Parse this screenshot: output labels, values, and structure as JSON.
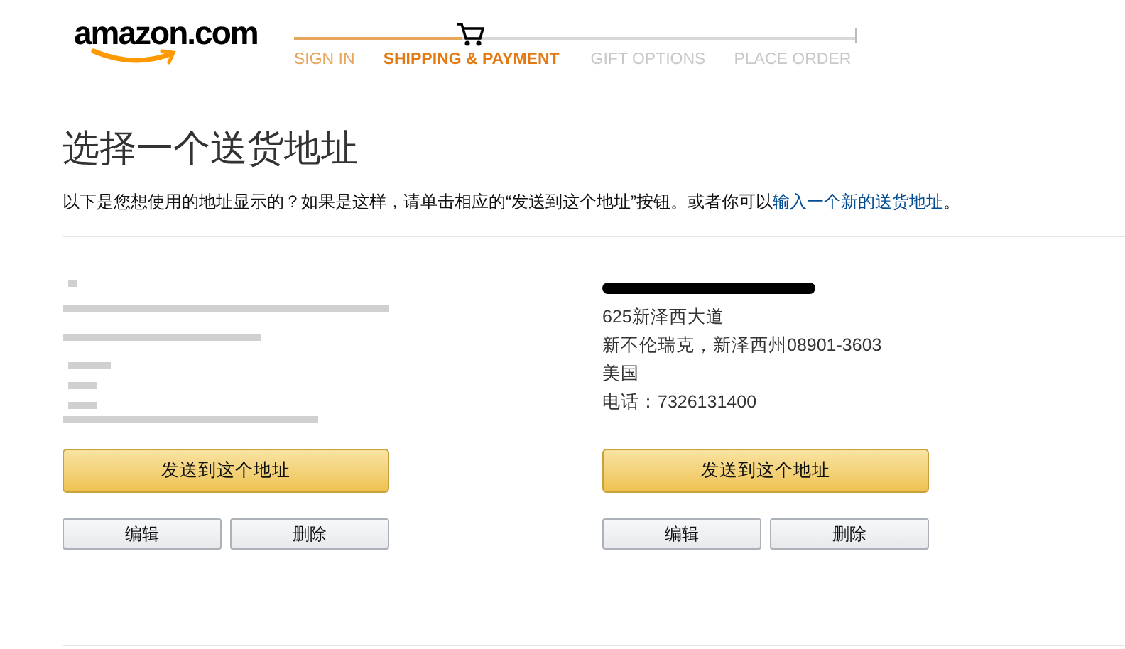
{
  "header": {
    "logo": "amazon.com",
    "steps": [
      {
        "label": "SIGN IN",
        "selected": false
      },
      {
        "label": "SHIPPING & PAYMENT",
        "selected": true
      },
      {
        "label": "GIFT OPTIONS",
        "selected": false
      },
      {
        "label": "PLACE ORDER",
        "selected": false
      }
    ]
  },
  "title": "选择一个送货地址",
  "intro": {
    "text": "以下是您想使用的地址显示的？如果是这样，请单击相应的“发送到这个地址”按钮。或者你可以",
    "link": "输入一个新的送货地址",
    "end": "。"
  },
  "addresses": [
    {
      "kind": "redacted",
      "ship_button": "发送到这个地址",
      "edit_button": "编辑",
      "delete_button": "删除"
    },
    {
      "kind": "shown",
      "name_redacted": true,
      "lines": [
        "625新泽西大道",
        "新不伦瑞克，新泽西州08901-3603",
        "美国",
        "电话：7326131400"
      ],
      "ship_button": "发送到这个地址",
      "edit_button": "编辑",
      "delete_button": "删除"
    }
  ]
}
